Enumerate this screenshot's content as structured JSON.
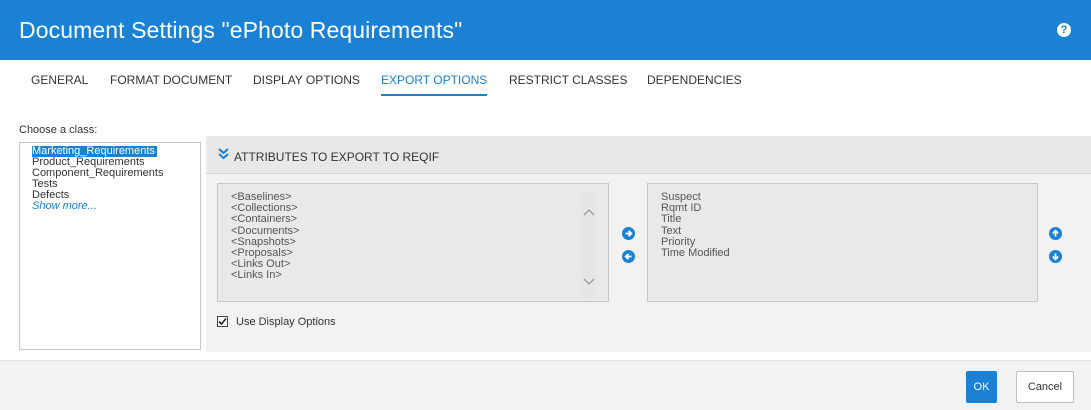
{
  "dialog": {
    "title": "Document Settings \"ePhoto Requirements\"",
    "help_icon": "?"
  },
  "tabs": [
    {
      "label": "GENERAL",
      "active": false
    },
    {
      "label": "FORMAT DOCUMENT",
      "active": false
    },
    {
      "label": "DISPLAY OPTIONS",
      "active": false
    },
    {
      "label": "EXPORT OPTIONS",
      "active": true
    },
    {
      "label": "RESTRICT CLASSES",
      "active": false
    },
    {
      "label": "DEPENDENCIES",
      "active": false
    }
  ],
  "class_chooser": {
    "label": "Choose a class:",
    "items": [
      {
        "label": "Marketing_Requirements",
        "selected": true
      },
      {
        "label": "Product_Requirements",
        "selected": false
      },
      {
        "label": "Component_Requirements",
        "selected": false
      },
      {
        "label": "Tests",
        "selected": false
      },
      {
        "label": "Defects",
        "selected": false
      }
    ],
    "show_more": "Show more..."
  },
  "export_panel": {
    "header_icon": "double-chevron-down",
    "header_title": "ATTRIBUTES TO EXPORT TO REQIF",
    "available": [
      "<Baselines>",
      "<Collections>",
      "<Containers>",
      "<Documents>",
      "<Snapshots>",
      "<Proposals>",
      "<Links Out>",
      "<Links In>"
    ],
    "selected": [
      "Suspect",
      "Rqmt ID",
      "Title",
      "Text",
      "Priority",
      "Time Modified"
    ],
    "use_display_options_label": "Use Display Options",
    "use_display_options_checked": true
  },
  "footer": {
    "ok_label": "OK",
    "cancel_label": "Cancel"
  },
  "colors": {
    "accent": "#1a81d4",
    "panel_bg": "#f2f2f2",
    "list_bg": "#e9e9e9"
  }
}
